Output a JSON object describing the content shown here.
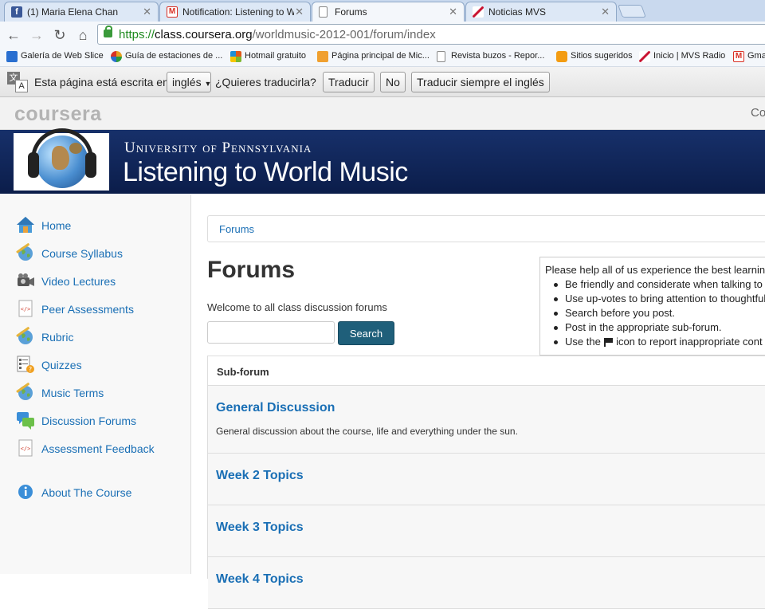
{
  "browser": {
    "tabs": [
      {
        "label": "(1) Maria Elena Chan",
        "icon": "facebook-icon",
        "color": "#3b5998"
      },
      {
        "label": "Notification: Listening to Worl",
        "icon": "gmail-icon",
        "color": "#d93025"
      },
      {
        "label": "Forums",
        "icon": "page-icon",
        "color": "#ffffff"
      },
      {
        "label": "Noticias MVS",
        "icon": "mvs-icon",
        "color": "#c8102e"
      }
    ],
    "close_glyph": "✕",
    "url": {
      "scheme": "https://",
      "host": "class.coursera.org",
      "path": "/worldmusic-2012-001/forum/index"
    },
    "bookmarks": [
      {
        "label": "Galería de Web Slice",
        "icon": "webslice-icon",
        "color": "#2a6fd0"
      },
      {
        "label": "Guía de estaciones de ...",
        "icon": "msn-icon",
        "color": "#e8a020"
      },
      {
        "label": "Hotmail gratuito",
        "icon": "windows-icon",
        "color": "#e05a1a"
      },
      {
        "label": "Página principal de Mic...",
        "icon": "ms-icon",
        "color": "#f0a030"
      },
      {
        "label": "Revista buzos - Repor...",
        "icon": "page-icon",
        "color": "#ffffff"
      },
      {
        "label": "Sitios sugeridos",
        "icon": "suggested-icon",
        "color": "#f39c12"
      },
      {
        "label": "Inicio | MVS Radio",
        "icon": "mvs-icon",
        "color": "#c8102e"
      },
      {
        "label": "Gmail",
        "icon": "gmail-icon",
        "color": "#d93025"
      }
    ],
    "translate": {
      "prefix": "Esta página está escrita en",
      "language": "inglés",
      "question": "¿Quieres traducirla?",
      "translate_btn": "Traducir",
      "no_btn": "No",
      "always_btn": "Traducir siempre el inglés"
    }
  },
  "site": {
    "logo": "coursera",
    "header_right": "Co",
    "university": "University of Pennsylvania",
    "course_title": "Listening to World Music"
  },
  "sidebar": {
    "items": [
      {
        "label": "Home",
        "icon": "home-icon"
      },
      {
        "label": "Course Syllabus",
        "icon": "globe-icon"
      },
      {
        "label": "Video Lectures",
        "icon": "video-camera-icon"
      },
      {
        "label": "Peer Assessments",
        "icon": "code-document-icon"
      },
      {
        "label": "Rubric",
        "icon": "globe-icon"
      },
      {
        "label": "Quizzes",
        "icon": "quiz-icon"
      },
      {
        "label": "Music Terms",
        "icon": "globe-icon"
      },
      {
        "label": "Discussion Forums",
        "icon": "chat-bubbles-icon"
      },
      {
        "label": "Assessment Feedback",
        "icon": "code-document-icon"
      },
      {
        "label": "About The Course",
        "icon": "info-icon"
      }
    ]
  },
  "main": {
    "breadcrumb": "Forums",
    "title": "Forums",
    "welcome": "Welcome to all class discussion forums",
    "search": {
      "value": "",
      "button": "Search"
    },
    "guidelines": {
      "intro": "Please help all of us experience the best learnin",
      "items": [
        "Be friendly and considerate when talking to",
        "Use up-votes to bring attention to thoughtful",
        "Search before you post.",
        "Post in the appropriate sub-forum."
      ],
      "flag_item_before": "Use the",
      "flag_item_after": "icon to report inappropriate cont"
    },
    "table_header": "Sub-forum",
    "forums": [
      {
        "name": "General Discussion",
        "description": "General discussion about the course, life and everything under the sun."
      },
      {
        "name": "Week 2 Topics",
        "description": ""
      },
      {
        "name": "Week 3 Topics",
        "description": ""
      },
      {
        "name": "Week 4 Topics",
        "description": ""
      }
    ]
  }
}
